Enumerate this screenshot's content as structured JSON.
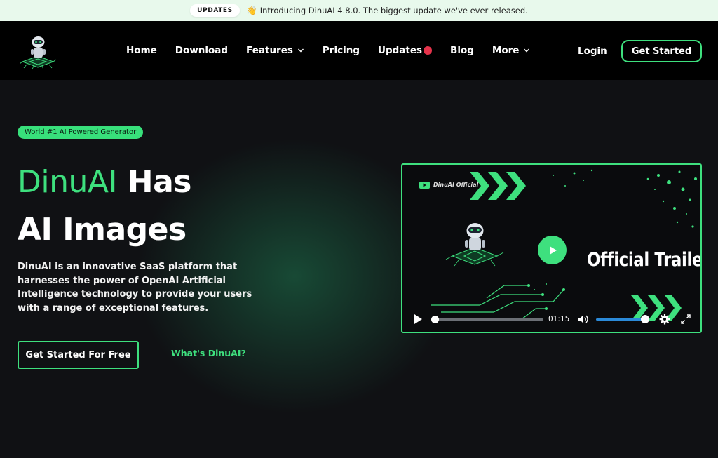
{
  "announcement": {
    "badge": "UPDATES",
    "emoji": "👋",
    "message": "Introducing DinuAI 4.8.0. The biggest update we've ever released."
  },
  "nav": {
    "links": [
      {
        "label": "Home",
        "dropdown": false
      },
      {
        "label": "Download",
        "dropdown": false
      },
      {
        "label": "Features",
        "dropdown": true
      },
      {
        "label": "Pricing",
        "dropdown": false
      },
      {
        "label": "Updates",
        "dropdown": false,
        "notification_dot": true
      },
      {
        "label": "Blog",
        "dropdown": false
      },
      {
        "label": "More",
        "dropdown": true
      }
    ],
    "login": "Login",
    "cta": "Get Started"
  },
  "hero": {
    "pill": "World #1 AI Powered Generator",
    "title_brand": "DinuAI",
    "title_rest_line1": " Has",
    "title_line2": "AI Images",
    "description": "DinuAI is an innovative SaaS platform that harnesses the power of OpenAI Artificial Intelligence technology to provide your users with a range of exceptional features.",
    "primary_button": "Get Started For Free",
    "secondary_link": "What's DinuAI?"
  },
  "video": {
    "channel": "DinuAI Official",
    "title": "Official Trailer",
    "current_time": "01:15",
    "progress": 0.0,
    "volume": 0.9
  },
  "colors": {
    "accent": "#3ee07e",
    "background": "#101114",
    "nav_background": "#000000",
    "announcement_background": "#e8f9ec",
    "notification_dot": "#e5334b",
    "volume_bar": "#2b8ad8"
  }
}
